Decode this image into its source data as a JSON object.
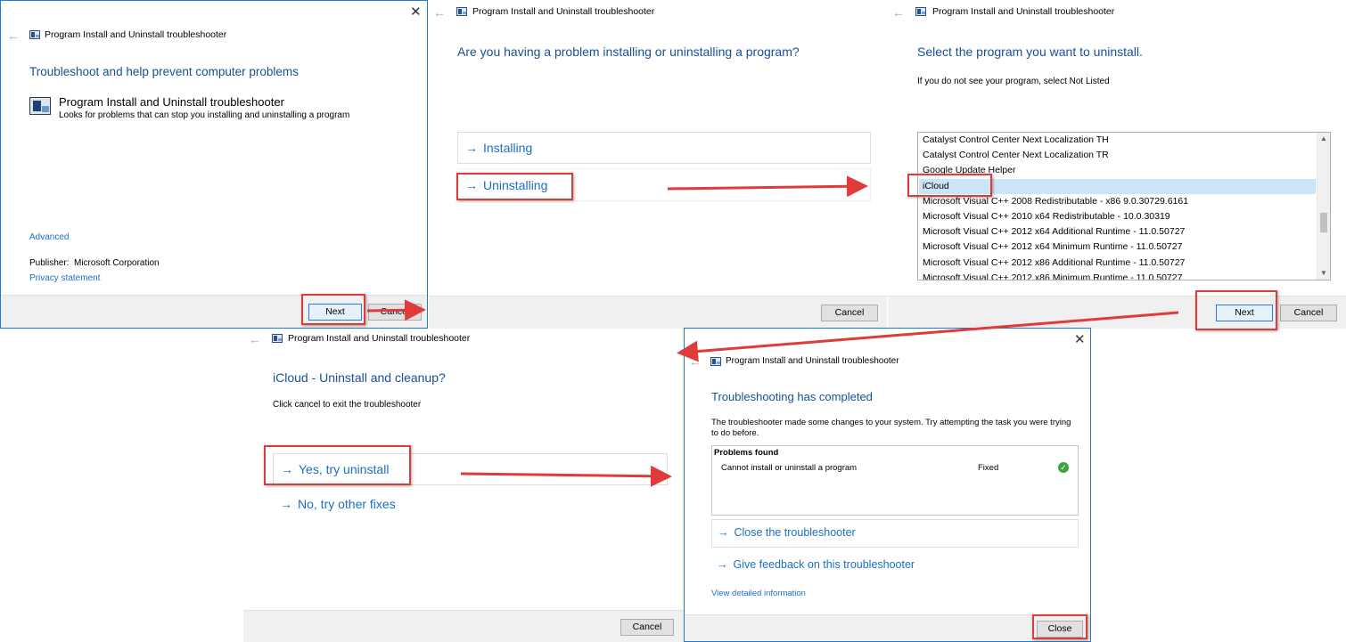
{
  "window_title": "Program Install and Uninstall troubleshooter",
  "icons": {
    "back": "back-arrow-icon",
    "app": "troubleshooter-app-icon",
    "close": "close-icon",
    "arrow": "right-arrow-icon",
    "check": "check-circle-icon"
  },
  "colors": {
    "heading": "#1a4f96",
    "link": "#1a6fc4",
    "highlight_red": "#e03a3a",
    "selection": "#cce4f7",
    "window_border": "#1e7ad4"
  },
  "step1": {
    "heading": "Troubleshoot and help prevent computer problems",
    "item_title": "Program Install and Uninstall troubleshooter",
    "item_desc": "Looks for problems that can stop you installing and uninstalling a program",
    "advanced": "Advanced",
    "publisher_label": "Publisher:",
    "publisher_value": "Microsoft Corporation",
    "privacy": "Privacy statement",
    "next": "Next",
    "cancel": "Cancel"
  },
  "step2": {
    "heading": "Are you having a problem installing or uninstalling a program?",
    "option_installing": "Installing",
    "option_uninstalling": "Uninstalling",
    "cancel": "Cancel"
  },
  "step3": {
    "heading": "Select the program you want to uninstall.",
    "subtext": "If you do not see your program, select Not Listed",
    "programs": [
      "Catalyst Control Center Next Localization TH",
      "Catalyst Control Center Next Localization TR",
      "Google Update Helper",
      "iCloud",
      "Microsoft Visual C++ 2008 Redistributable - x86 9.0.30729.6161",
      "Microsoft Visual C++ 2010  x64 Redistributable - 10.0.30319",
      "Microsoft Visual C++ 2012 x64 Additional Runtime - 11.0.50727",
      "Microsoft Visual C++ 2012 x64 Minimum Runtime - 11.0.50727",
      "Microsoft Visual C++ 2012 x86 Additional Runtime - 11.0.50727",
      "Microsoft Visual C++ 2012 x86 Minimum Runtime - 11.0.50727"
    ],
    "selected_program": "iCloud",
    "next": "Next",
    "cancel": "Cancel"
  },
  "step4": {
    "heading": "iCloud - Uninstall and cleanup?",
    "subtext": "Click cancel to exit the troubleshooter",
    "option_yes": "Yes, try uninstall",
    "option_no": "No, try other fixes",
    "cancel": "Cancel"
  },
  "step5": {
    "heading": "Troubleshooting has completed",
    "desc_line1": "The troubleshooter made some changes to your system. Try attempting the task you were trying",
    "desc_line2": "to do before.",
    "problems_header": "Problems found",
    "problem_name": "Cannot install or uninstall a program",
    "problem_status": "Fixed",
    "close_troubleshooter": "Close the troubleshooter",
    "give_feedback": "Give feedback on this troubleshooter",
    "view_details": "View detailed information",
    "close": "Close"
  }
}
